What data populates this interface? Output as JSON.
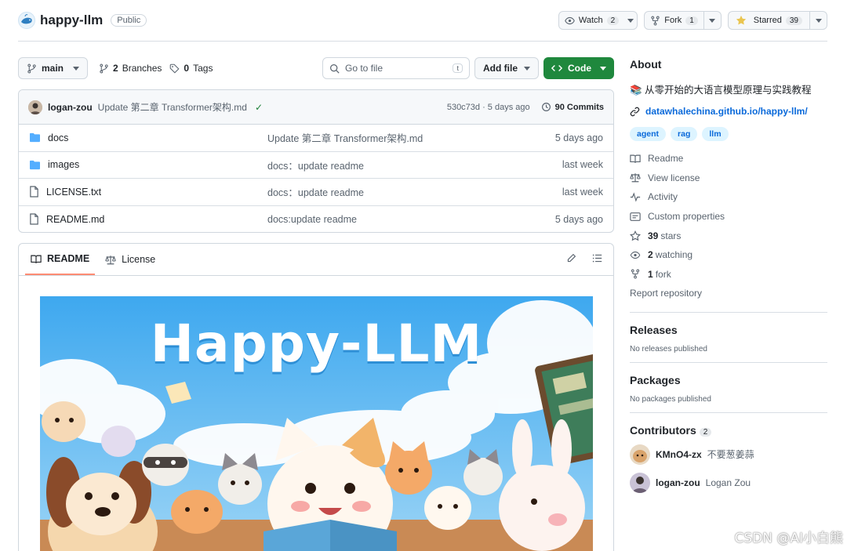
{
  "repo": {
    "name": "happy-llm",
    "visibility": "Public"
  },
  "header_actions": {
    "watch_label": "Watch",
    "watch_count": "2",
    "fork_label": "Fork",
    "fork_count": "1",
    "star_label": "Starred",
    "star_count": "39"
  },
  "toolbar": {
    "branch": "main",
    "branches_count": "2",
    "branches_label": "Branches",
    "tags_count": "0",
    "tags_label": "Tags",
    "search_placeholder": "Go to file",
    "search_shortcut": "t",
    "add_file_label": "Add file",
    "code_label": "Code"
  },
  "latest_commit": {
    "user": "logan-zou",
    "message": "Update 第二章 Transformer架构.md",
    "hash_time": "530c73d · 5 days ago",
    "commits_label": "90 Commits"
  },
  "files": [
    {
      "name": "docs",
      "type": "folder",
      "message": "Update 第二章 Transformer架构.md",
      "date": "5 days ago"
    },
    {
      "name": "images",
      "type": "folder",
      "message": "docs：update readme",
      "date": "last week"
    },
    {
      "name": "LICENSE.txt",
      "type": "file",
      "message": "docs：update readme",
      "date": "last week"
    },
    {
      "name": "README.md",
      "type": "file",
      "message": "docs:update readme",
      "date": "5 days ago"
    }
  ],
  "readme": {
    "tab_readme": "README",
    "tab_license": "License",
    "banner_title": "Happy-LLM"
  },
  "sidebar": {
    "about_title": "About",
    "description": "📚 从零开始的大语言模型原理与实践教程",
    "website": "datawhalechina.github.io/happy-llm/",
    "topics": [
      "agent",
      "rag",
      "llm"
    ],
    "links": {
      "readme": "Readme",
      "license": "View license",
      "activity": "Activity",
      "custom_properties": "Custom properties",
      "stars_count": "39",
      "stars_label": "stars",
      "watching_count": "2",
      "watching_label": "watching",
      "fork_count": "1",
      "fork_label": "fork",
      "report": "Report repository"
    },
    "releases_title": "Releases",
    "releases_empty": "No releases published",
    "packages_title": "Packages",
    "packages_empty": "No packages published",
    "contributors_title": "Contributors",
    "contributors_count": "2",
    "contributors": [
      {
        "login": "KMnO4-zx",
        "name": "不要葱姜蒜"
      },
      {
        "login": "logan-zou",
        "name": "Logan Zou"
      }
    ]
  },
  "watermark": "CSDN @AI小白熊",
  "colors": {
    "accent_blue": "#0969da",
    "code_green": "#1f883d",
    "folder_blue": "#54aeff",
    "tab_underline": "#fd8c73",
    "banner_sky": "#4fb3f0"
  }
}
